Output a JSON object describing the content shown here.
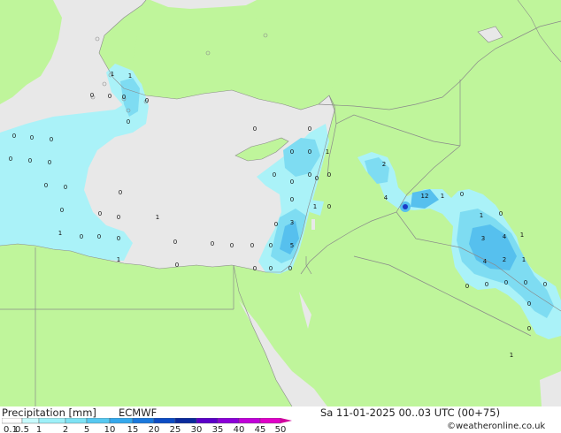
{
  "header": {
    "title": "Precipitation [mm]",
    "model": "ECMWF",
    "datetime": "Sa 11-01-2025 00..03 UTC (00+75)",
    "credit": "©weatheronline.co.uk"
  },
  "legend": {
    "ticks": [
      "0.1",
      "0.5",
      "1",
      "2",
      "5",
      "10",
      "15",
      "20",
      "25",
      "30",
      "35",
      "40",
      "45",
      "50"
    ],
    "colors": [
      "#ffffff",
      "#c8fafc",
      "#9ef0f8",
      "#7ee2f4",
      "#56c8f0",
      "#34a8ec",
      "#1a78dc",
      "#0c4cc4",
      "#0a2a9c",
      "#5a00c8",
      "#8a00d8",
      "#c000d8",
      "#e000c8",
      "#e800a0",
      "#d0009c"
    ]
  },
  "colors": {
    "land": "#bff59b",
    "sea": "#e8e8e8",
    "border": "#8a8a8a",
    "rain_light": "#aaf2f8",
    "rain_mid": "#7edcf2",
    "rain_heavy": "#56c0ee",
    "rain_core": "#1a3cc8"
  },
  "map_values": [
    "1",
    "1",
    "0",
    "0",
    "0",
    "0",
    "0",
    "0",
    "0",
    "0",
    "0",
    "0",
    "0",
    "0",
    "0",
    "0",
    "0",
    "0",
    "1",
    "0",
    "0",
    "0",
    "0",
    "0",
    "0",
    "0",
    "0",
    "0",
    "0",
    "0",
    "0",
    "1",
    "0",
    "0",
    "3",
    "0",
    "0",
    "5",
    "0",
    "0",
    "0",
    "0",
    "1",
    "1",
    "0",
    "0",
    "0",
    "0",
    "0",
    "1",
    "2",
    "4",
    "12",
    "1",
    "0",
    "1",
    "0",
    "3",
    "4",
    "1",
    "4",
    "2",
    "1",
    "0",
    "0",
    "0",
    "0",
    "0",
    "0",
    "0",
    "1"
  ]
}
